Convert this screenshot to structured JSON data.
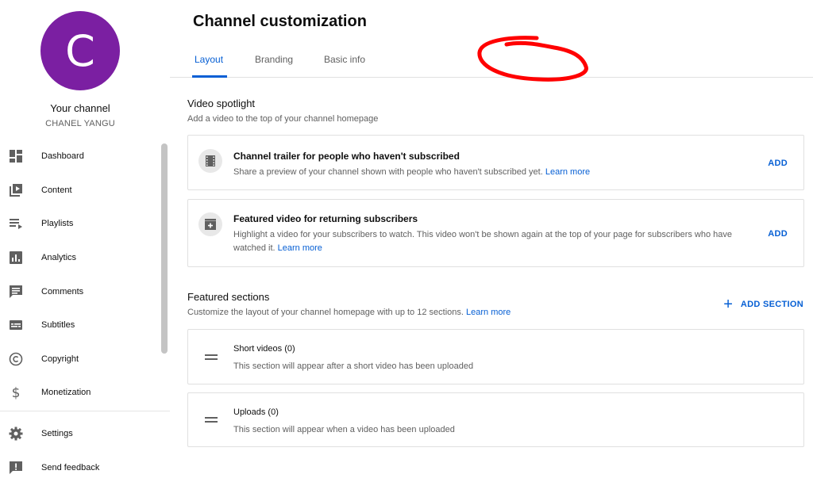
{
  "sidebar": {
    "avatar_letter": "C",
    "avatar_color": "#7b1fa2",
    "your_channel": "Your channel",
    "channel_name": "CHANEL YANGU",
    "items": [
      {
        "label": "Dashboard",
        "icon": "dashboard-icon"
      },
      {
        "label": "Content",
        "icon": "content-icon"
      },
      {
        "label": "Playlists",
        "icon": "playlists-icon"
      },
      {
        "label": "Analytics",
        "icon": "analytics-icon"
      },
      {
        "label": "Comments",
        "icon": "comments-icon"
      },
      {
        "label": "Subtitles",
        "icon": "subtitles-icon"
      },
      {
        "label": "Copyright",
        "icon": "copyright-icon"
      },
      {
        "label": "Monetization",
        "icon": "monetization-icon"
      }
    ],
    "bottom_items": [
      {
        "label": "Settings",
        "icon": "gear-icon"
      },
      {
        "label": "Send feedback",
        "icon": "feedback-icon"
      }
    ]
  },
  "main": {
    "title": "Channel customization",
    "tabs": [
      {
        "label": "Layout",
        "active": true
      },
      {
        "label": "Branding",
        "active": false
      },
      {
        "label": "Basic info",
        "active": false
      }
    ],
    "annotation_color": "#ff0000",
    "video_spotlight": {
      "title": "Video spotlight",
      "description": "Add a video to the top of your channel homepage",
      "cards": [
        {
          "title": "Channel trailer for people who haven't subscribed",
          "description": "Share a preview of your channel shown with people who haven't subscribed yet.",
          "link": "Learn more",
          "action": "ADD",
          "icon": "film-icon"
        },
        {
          "title": "Featured video for returning subscribers",
          "description": "Highlight a video for your subscribers to watch. This video won't be shown again at the top of your page for subscribers who have watched it.",
          "link": "Learn more",
          "action": "ADD",
          "icon": "featured-video-icon"
        }
      ]
    },
    "featured_sections": {
      "title": "Featured sections",
      "description": "Customize the layout of your channel homepage with up to 12 sections.",
      "link": "Learn more",
      "add_label": "ADD SECTION",
      "sections": [
        {
          "name": "Short videos",
          "count": "(0)",
          "description": "This section will appear after a short video has been uploaded"
        },
        {
          "name": "Uploads",
          "count": "(0)",
          "description": "This section will appear when a video has been uploaded"
        }
      ]
    }
  },
  "colors": {
    "accent": "#065fd4",
    "text_secondary": "#606060"
  }
}
